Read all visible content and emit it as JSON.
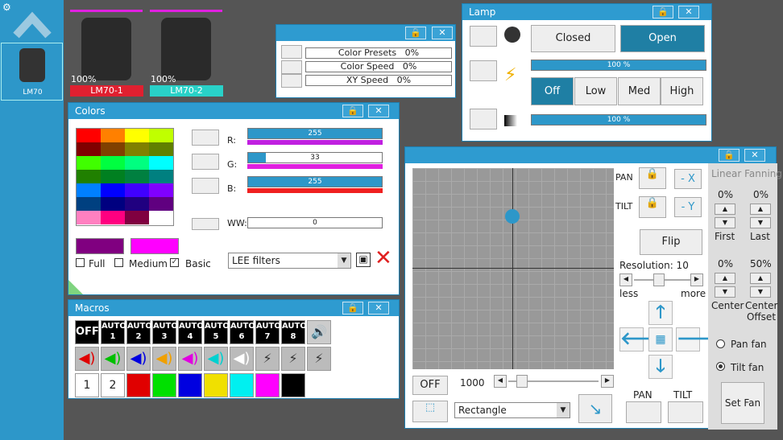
{
  "fixtures": {
    "selected_label": "LM70",
    "items": [
      {
        "percent": "100%",
        "name": "LM70-1",
        "color": "#e02030"
      },
      {
        "percent": "100%",
        "name": "LM70-2",
        "color": "#29d1c8"
      }
    ]
  },
  "presets": {
    "rows": [
      {
        "label": "Color Presets",
        "value": "0%"
      },
      {
        "label": "Color Speed",
        "value": "0%"
      },
      {
        "label": "XY Speed",
        "value": "0%"
      }
    ]
  },
  "lamp": {
    "title": "Lamp",
    "closed": "Closed",
    "open": "Open",
    "dimmer1": "100 %",
    "dimmer2": "100 %",
    "off": "Off",
    "low": "Low",
    "med": "Med",
    "high": "High"
  },
  "colors": {
    "title": "Colors",
    "r_label": "R:",
    "g_label": "G:",
    "b_label": "B:",
    "ww_label": "WW:",
    "r": 255,
    "g": 33,
    "b": 255,
    "ww": 0,
    "full": "Full",
    "medium": "Medium",
    "basic": "Basic",
    "filter": "LEE filters",
    "palette": [
      "#ff0000",
      "#ff8000",
      "#ffff00",
      "#c0ff00",
      "#800000",
      "#804000",
      "#808000",
      "#608000",
      "#40ff00",
      "#00ff40",
      "#00ff80",
      "#00ffff",
      "#208000",
      "#008020",
      "#008040",
      "#008080",
      "#0080ff",
      "#0000ff",
      "#4000ff",
      "#8000ff",
      "#004080",
      "#000080",
      "#200080",
      "#600080",
      "#ff80c0",
      "#ff0080",
      "#800040",
      "#ffffff"
    ],
    "swatch1": "#800080",
    "swatch2": "#ff00ff"
  },
  "macros": {
    "title": "Macros",
    "off": "OFF",
    "auto": "AUTO",
    "autos": [
      "1",
      "2",
      "3",
      "4",
      "5",
      "6",
      "7",
      "8"
    ],
    "nums": [
      "1",
      "2"
    ],
    "swatches": [
      "#e00000",
      "#00e000",
      "#0000e0",
      "#f0e000",
      "#00f0f0",
      "#ff00ff",
      "#000000"
    ],
    "speaker_colors": [
      "#e00000",
      "#00c000",
      "#0000e0",
      "#f0a000",
      "#e000e0",
      "#00d0d0",
      "#ffffff"
    ]
  },
  "movement": {
    "title": "Linear Fanning",
    "pan": "PAN",
    "tilt": "TILT",
    "neg_x": "- X",
    "neg_y": "- Y",
    "flip": "Flip",
    "resolution": "Resolution: 10",
    "less": "less",
    "more": "more",
    "off": "OFF",
    "speed": "1000",
    "shape": "Rectangle",
    "pan_label": "PAN",
    "tilt_label": "TILT",
    "fan": [
      {
        "value": "0%",
        "label": "First"
      },
      {
        "value": "0%",
        "label": "Last"
      },
      {
        "value": "0%",
        "label": "Center"
      },
      {
        "value": "50%",
        "label": "Center Offset"
      }
    ],
    "pan_fan": "Pan fan",
    "tilt_fan": "Tilt fan",
    "set_fan": "Set Fan"
  }
}
